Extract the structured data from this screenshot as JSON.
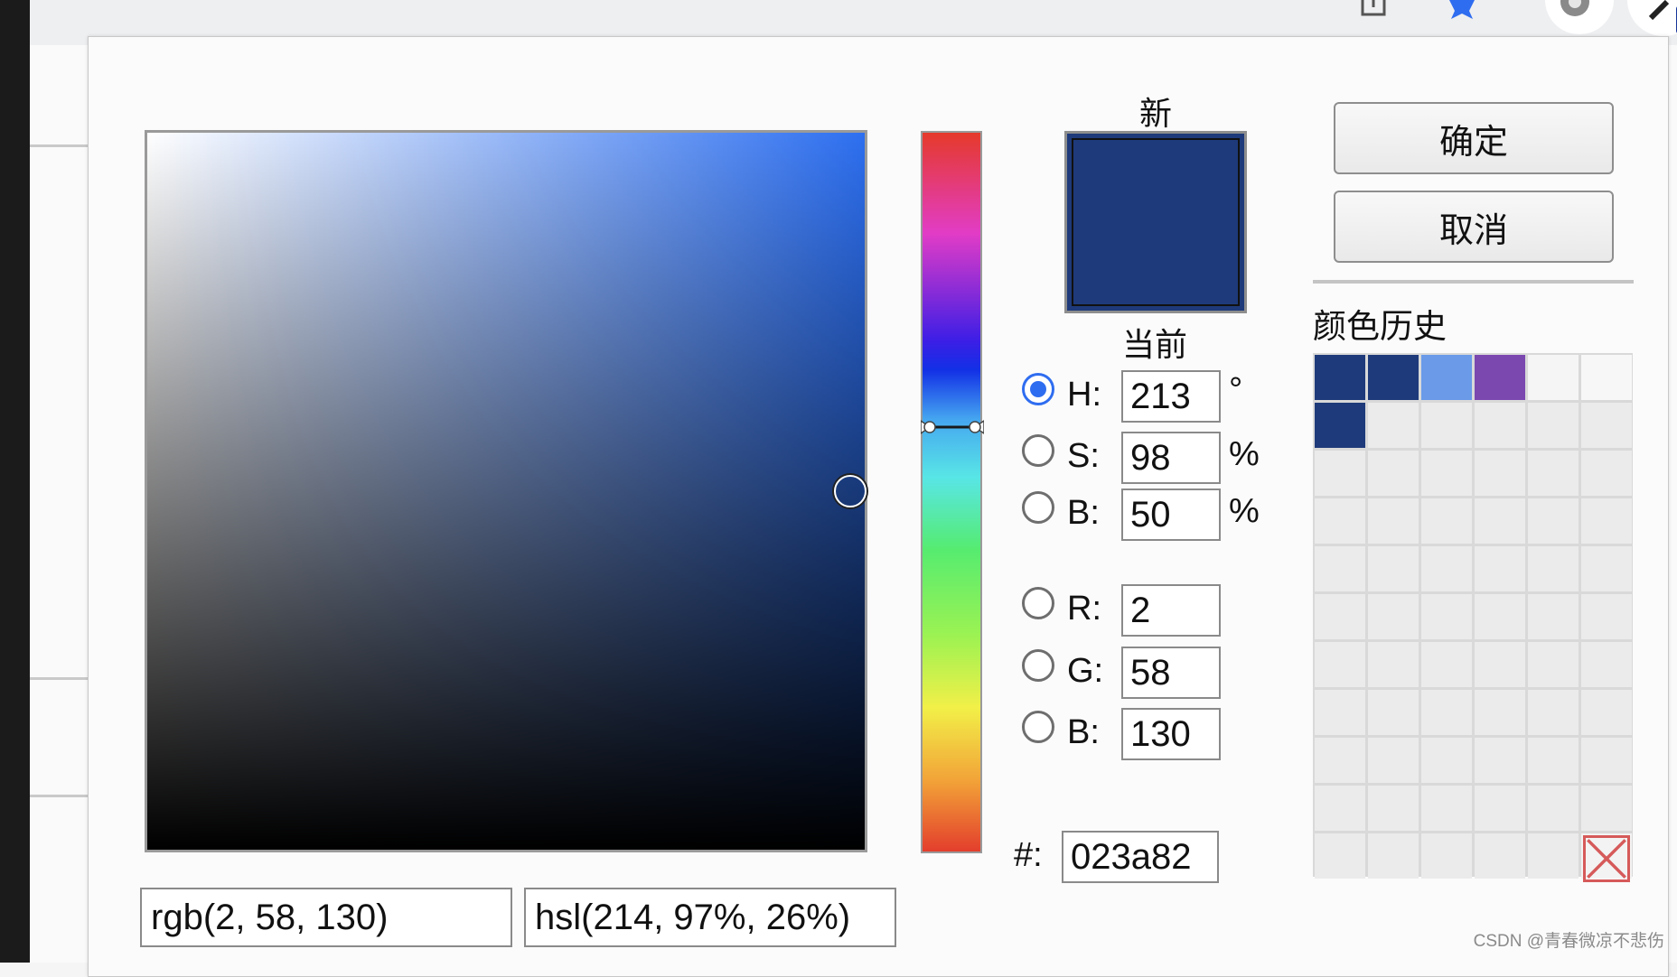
{
  "dialog": {
    "new_label": "新",
    "current_label": "当前",
    "new_color": "#1e3a7a",
    "sv_cursor_pos": {
      "saturation": 0.98,
      "brightness": 0.5
    },
    "hue_marker_pos": 0.41,
    "fields": {
      "h": {
        "label": "H:",
        "value": "213",
        "unit": "°",
        "checked": true
      },
      "s": {
        "label": "S:",
        "value": "98",
        "unit": "%"
      },
      "bright": {
        "label": "B:",
        "value": "50",
        "unit": "%"
      },
      "r": {
        "label": "R:",
        "value": "2"
      },
      "g": {
        "label": "G:",
        "value": "58"
      },
      "blue": {
        "label": "B:",
        "value": "130"
      }
    },
    "hex_label": "#:",
    "hex_value": "023a82",
    "rgb_text": "rgb(2, 58, 130)",
    "hsl_text": "hsl(214, 97%, 26%)",
    "ok_label": "确定",
    "cancel_label": "取消",
    "history_title": "颜色历史",
    "history_colors": [
      "#1e3a7a",
      "#1e3a7a",
      "#6a9ae8",
      "#7b48b0",
      "#f5f5f5",
      "#f7f7f7",
      "#1e3a7a"
    ]
  },
  "watermark": "CSDN @青春微凉不悲伤",
  "icons": [
    "extension-icon",
    "bookmark-star-icon",
    "settings-gear-icon",
    "profile-pen-icon",
    "color-picker-cursor-icon",
    "clear-history-icon"
  ],
  "colors": {
    "accent": "#2f6df0",
    "hue_top": "#e53a2a",
    "sv_hue": "#2d6ff0",
    "clear_red": "#d65a5a"
  }
}
